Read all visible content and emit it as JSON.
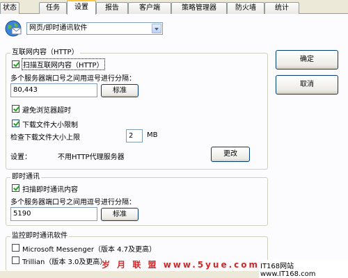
{
  "tabs": [
    {
      "label": "状态",
      "active": false
    },
    {
      "label": "任务",
      "active": false
    },
    {
      "label": "设置",
      "active": true
    },
    {
      "label": "报告",
      "active": false
    },
    {
      "label": "客户端",
      "active": false
    },
    {
      "label": "策略管理器",
      "active": false
    },
    {
      "label": "防火墙",
      "active": false
    },
    {
      "label": "统计",
      "active": false
    }
  ],
  "category_select": {
    "value": "网页/即时通讯软件",
    "icon": "globe-mail-icon"
  },
  "http_group": {
    "legend": "互联网内容（HTTP）",
    "scan_http": {
      "label": "扫描互联网内容（HTTP）",
      "checked": true
    },
    "ports_label": "多个服务器端口号之间用逗号进行分隔：",
    "ports_value": "80,443",
    "ports_default_button": "标准",
    "avoid_timeout": {
      "label": "避免浏览器超时",
      "checked": true
    },
    "limit_download": {
      "label": "下载文件大小限制",
      "checked": true
    },
    "max_size_label": "检查下载文件大小上限",
    "max_size_value": "2",
    "max_size_unit": "MB",
    "settings_label": "设置：",
    "settings_value": "不用HTTP代理服务器",
    "change_button": "更改"
  },
  "im_group": {
    "legend": "即时通讯",
    "scan_im": {
      "label": "扫描即时通讯内容",
      "checked": true
    },
    "ports_label": "多个服务器端口号之间用逗号进行分隔：",
    "ports_value": "5190",
    "ports_default_button": "标准"
  },
  "monitor_group": {
    "legend": "监控即时通讯软件",
    "items": [
      {
        "label": "Microsoft Messenger（版本 4.7及更高）",
        "checked": false
      },
      {
        "label": "Trillian（版本 3.0及更高）",
        "checked": false
      }
    ]
  },
  "buttons": {
    "ok": "确定",
    "cancel": "取消"
  },
  "watermark": {
    "text": "岁 月 联 盟  www.5yue.com",
    "site": "IT168网站 www.IT168.com"
  }
}
